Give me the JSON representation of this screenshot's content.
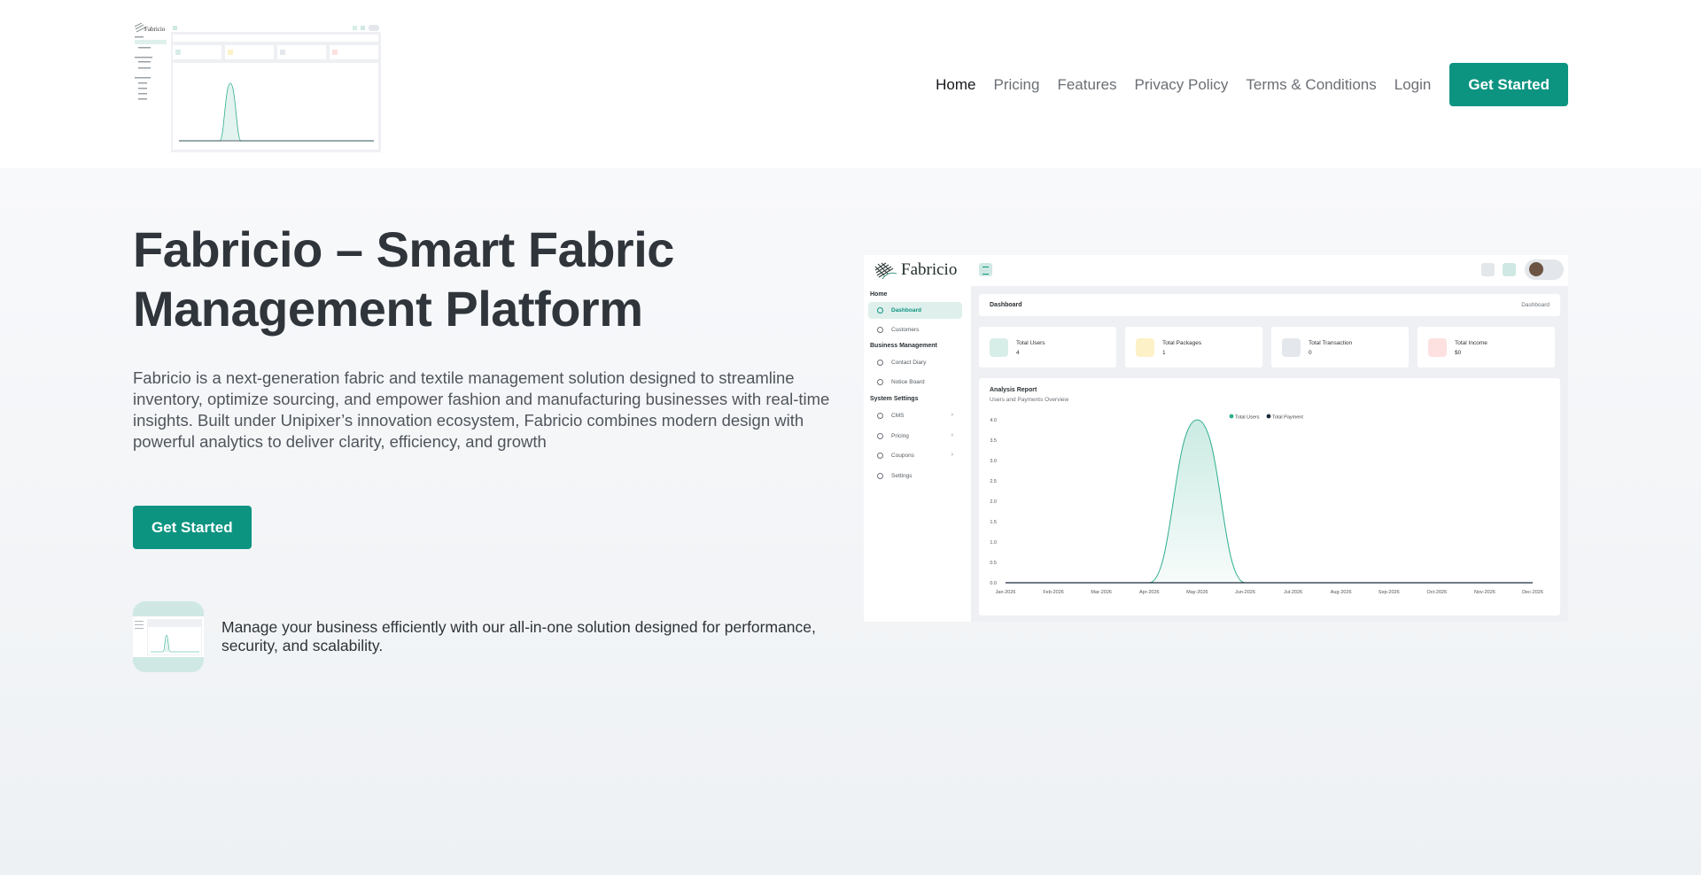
{
  "nav": {
    "items": [
      {
        "label": "Home",
        "active": true
      },
      {
        "label": "Pricing",
        "active": false
      },
      {
        "label": "Features",
        "active": false
      },
      {
        "label": "Privacy Policy",
        "active": false
      },
      {
        "label": "Terms & Conditions",
        "active": false
      },
      {
        "label": "Login",
        "active": false
      }
    ],
    "cta_label": "Get Started"
  },
  "hero": {
    "title": "Fabricio – Smart Fabric Management Platform",
    "description": "Fabricio is a next-generation fabric and textile management solution designed to streamline inventory, optimize sourcing, and empower fashion and manufacturing businesses with real-time insights. Built under Unipixer’s innovation ecosystem, Fabricio combines modern design with powerful analytics to deliver clarity, efficiency, and growth",
    "cta_label": "Get Started",
    "feature_text": "Manage your business efficiently with our all-in-one solution designed for performance, security, and scalability."
  },
  "preview": {
    "logo_text": "Fabricio",
    "sidebar": [
      {
        "type": "group",
        "label": "Home"
      },
      {
        "type": "item",
        "label": "Dashboard",
        "active": true,
        "icon": "dashboard-icon"
      },
      {
        "type": "item",
        "label": "Customers",
        "icon": "customers-icon"
      },
      {
        "type": "group",
        "label": "Business Management"
      },
      {
        "type": "item",
        "label": "Contact Diary",
        "icon": "phone-icon"
      },
      {
        "type": "item",
        "label": "Notice Board",
        "icon": "notice-icon"
      },
      {
        "type": "group",
        "label": "System Settings"
      },
      {
        "type": "item",
        "label": "CMS",
        "icon": "cms-icon",
        "chevron": true
      },
      {
        "type": "item",
        "label": "Pricing",
        "icon": "pricing-icon",
        "chevron": true
      },
      {
        "type": "item",
        "label": "Coupons",
        "icon": "coupon-icon",
        "chevron": true
      },
      {
        "type": "item",
        "label": "Settings",
        "icon": "gear-icon"
      }
    ],
    "breadcrumb_title": "Dashboard",
    "breadcrumb_right": "Dashboard",
    "stats": [
      {
        "label": "Total Users",
        "value": "4",
        "icon": "users-icon",
        "bg": "#d7ede8",
        "fg": "#0d9481"
      },
      {
        "label": "Total Packages",
        "value": "1",
        "icon": "package-icon",
        "bg": "#fdf1c7",
        "fg": "#e0a100"
      },
      {
        "label": "Total Transaction",
        "value": "0",
        "icon": "history-icon",
        "bg": "#e4e7eb",
        "fg": "#5a6068"
      },
      {
        "label": "Total Income",
        "value": "$0",
        "icon": "card-icon",
        "bg": "#fde0e0",
        "fg": "#e35757"
      }
    ],
    "chart_title": "Analysis Report",
    "chart_subtitle": "Users and Payments Overview"
  },
  "chart_data": {
    "type": "area",
    "categories": [
      "Jan-2026",
      "Feb-2026",
      "Mar-2026",
      "Apr-2026",
      "May-2026",
      "Jun-2026",
      "Jul-2026",
      "Aug-2026",
      "Sep-2026",
      "Oct-2026",
      "Nov-2026",
      "Dec-2026"
    ],
    "series": [
      {
        "name": "Total Users",
        "values": [
          0,
          0,
          0,
          0,
          4,
          0,
          0,
          0,
          0,
          0,
          0,
          0
        ],
        "color": "#2fae8f"
      },
      {
        "name": "Total Payment",
        "values": [
          0,
          0,
          0,
          0,
          0,
          0,
          0,
          0,
          0,
          0,
          0,
          0
        ],
        "color": "#1c2b3a"
      }
    ],
    "y_ticks": [
      "0.0",
      "0.5",
      "1.0",
      "1.5",
      "2.0",
      "2.5",
      "3.0",
      "3.5",
      "4.0"
    ],
    "ylim": [
      0,
      4
    ],
    "legend": "top-center",
    "grid": false
  },
  "colors": {
    "accent": "#0d9481",
    "accent_light": "#dff0ec"
  }
}
